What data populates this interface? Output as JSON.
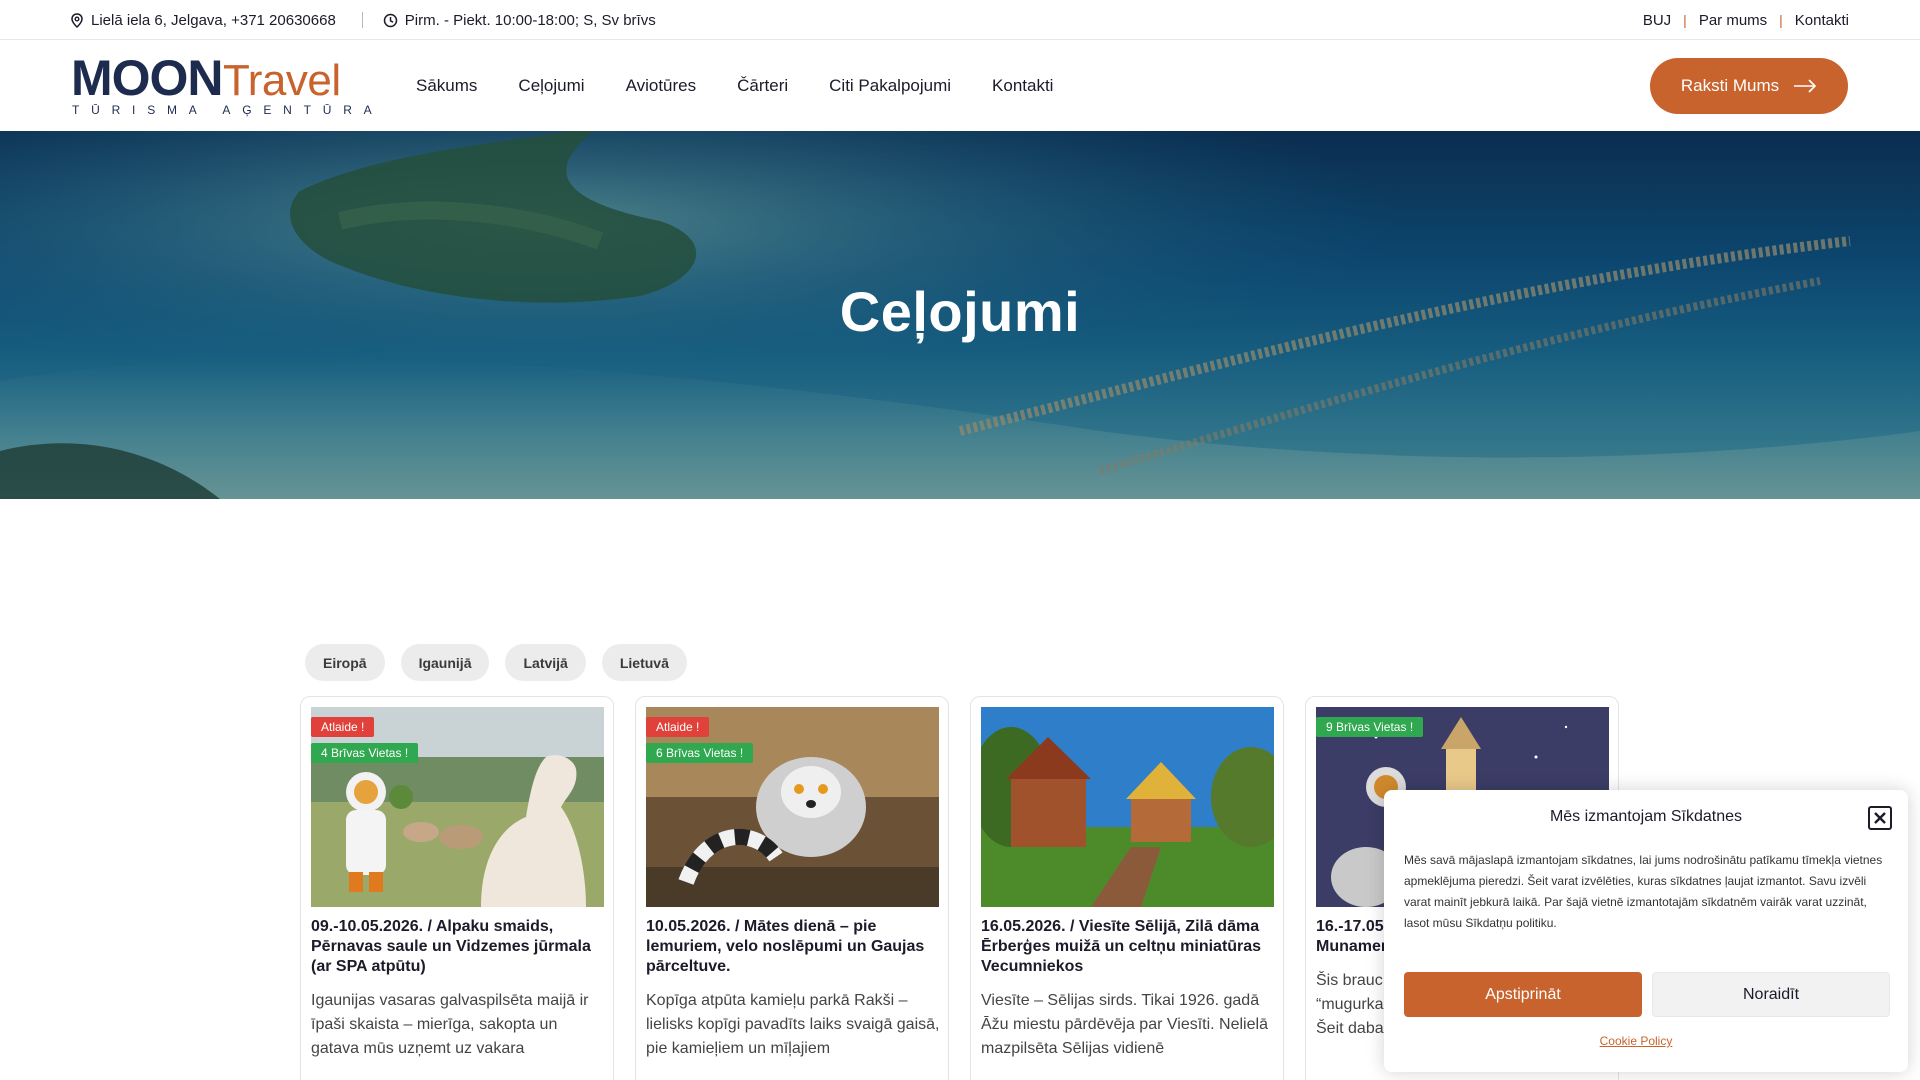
{
  "topbar": {
    "address": "Lielā iela 6, Jelgava, +371 20630668",
    "hours": "Pirm. - Piekt. 10:00-18:00; S, Sv brīvs",
    "links": [
      "BUJ",
      "Par mums",
      "Kontakti"
    ]
  },
  "logo": {
    "brand_main": "MOON",
    "brand_accent": "Travel",
    "tagline": "TŪRISMA AĢENTŪRA"
  },
  "nav": {
    "items": [
      "Sākums",
      "Ceļojumi",
      "Aviotūres",
      "Čārteri",
      "Citi Pakalpojumi",
      "Kontakti"
    ],
    "cta_label": "Raksti Mums"
  },
  "hero": {
    "title": "Ceļojumi"
  },
  "filters": [
    "Eiropā",
    "Igaunijā",
    "Latvijā",
    "Lietuvā"
  ],
  "cards": [
    {
      "badges": [
        {
          "text": "Atlaide !",
          "kind": "red"
        },
        {
          "text": "4 Brīvas Vietas !",
          "kind": "green"
        }
      ],
      "title": "09.-10.05.2026. / Alpaku smaids, Pērnavas saule un Vidzemes jūrmala (ar SPA atpūtu)",
      "excerpt": "Igaunijas vasaras galvaspilsēta maijā ir īpaši skaista – mierīga, sakopta un gatava mūs uzņemt uz vakara"
    },
    {
      "badges": [
        {
          "text": "Atlaide !",
          "kind": "red"
        },
        {
          "text": "6 Brīvas Vietas !",
          "kind": "green"
        }
      ],
      "title": "10.05.2026. / Mātes dienā – pie lemuriem, velo noslēpumi un Gaujas pārceltuve.",
      "excerpt": "Kopīga atpūta kamieļu parkā Rakši – lielisks kopīgi pavadīts laiks svaigā gaisā, pie kamieļiem un mīļajiem"
    },
    {
      "badges": [],
      "title": "16.05.2026. / Viesīte Sēlijā, Zilā dāma Ērberģes muižā un celtņu miniatūras Vecumniekos",
      "excerpt": "Viesīte – Sēlijas sirds. Tikai 1926. gadā Āžu miestu pārdēvēja par Viesīti. Nelielā mazpilsēta Sēlijas vidienē"
    },
    {
      "badges": [
        {
          "text": "9 Brīvas Vietas !",
          "kind": "green"
        }
      ],
      "title": "16.-17.05",
      "title_line2": "Munamer",
      "excerpt_lines": [
        "Šis brauc",
        "“mugurka",
        "Šeit daba"
      ]
    }
  ],
  "cookie": {
    "title": "Mēs izmantojam Sīkdatnes",
    "text": "Mēs savā mājaslapā izmantojam sīkdatnes, lai jums nodrošinātu patīkamu tīmekļa vietnes apmeklējuma pieredzi. Šeit varat izvēlēties, kuras sīkdatnes ļaujat izmantot. Savu izvēli varat mainīt jebkurā laikā. Par šajā vietnē izmantotajām sīkdatnēm vairāk varat uzzināt, lasot mūsu Sīkdatņu politiku.",
    "accept_label": "Apstiprināt",
    "deny_label": "Noraidīt",
    "policy_label": "Cookie Policy"
  },
  "colors": {
    "accent": "#c8632d",
    "navy": "#1d2b4e",
    "badge_red": "#e0413a",
    "badge_green": "#2fa84f"
  }
}
